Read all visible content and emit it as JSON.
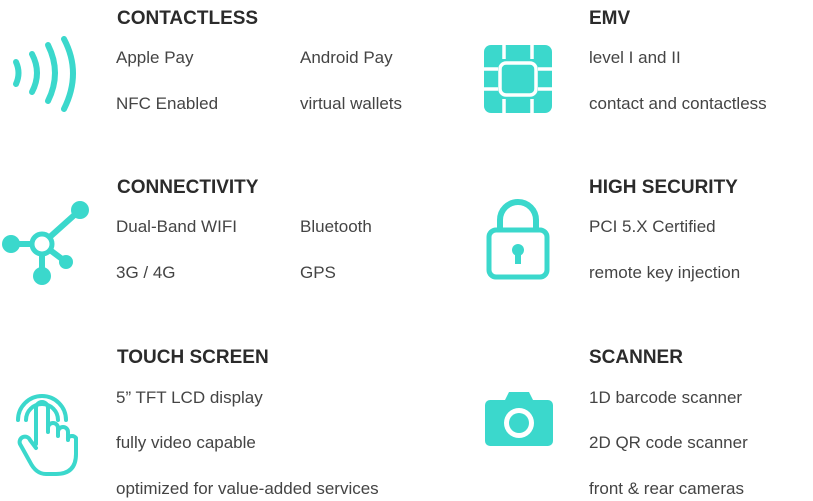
{
  "accent_color": "#3bd8cc",
  "sections": {
    "contactless": {
      "icon": "contactless-icon",
      "title": "CONTACTLESS",
      "features": [
        "Apple Pay",
        "Android Pay",
        "NFC Enabled",
        "virtual wallets"
      ]
    },
    "emv": {
      "icon": "chip-icon",
      "title": "EMV",
      "features": [
        "level I and II",
        "contact and contactless"
      ]
    },
    "connectivity": {
      "icon": "network-icon",
      "title": "CONNECTIVITY",
      "features": [
        "Dual-Band WIFI",
        "Bluetooth",
        "3G / 4G",
        "GPS"
      ]
    },
    "security": {
      "icon": "lock-icon",
      "title": "HIGH SECURITY",
      "features": [
        "PCI 5.X Certified",
        "remote key injection"
      ]
    },
    "touch": {
      "icon": "touch-icon",
      "title": "TOUCH SCREEN",
      "features": [
        "5” TFT LCD display",
        "fully video capable",
        "optimized for value-added services"
      ]
    },
    "scanner": {
      "icon": "camera-icon",
      "title": "SCANNER",
      "features": [
        "1D barcode scanner",
        "2D QR code scanner",
        "front & rear cameras"
      ]
    }
  }
}
